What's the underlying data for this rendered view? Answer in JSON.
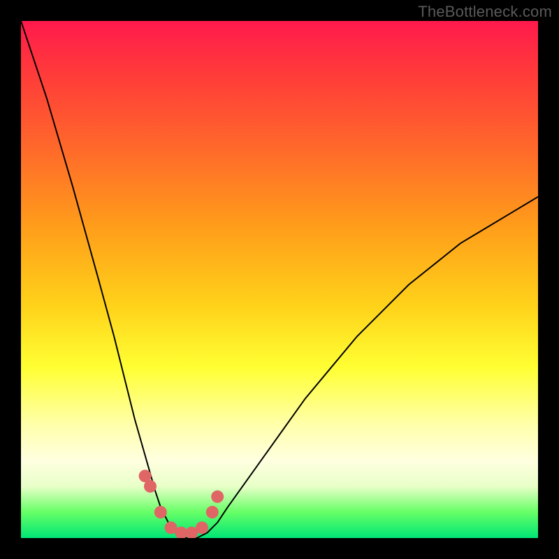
{
  "attribution": "TheBottleneck.com",
  "chart_data": {
    "type": "line",
    "title": "",
    "xlabel": "",
    "ylabel": "",
    "xlim": [
      0,
      100
    ],
    "ylim": [
      0,
      100
    ],
    "series": [
      {
        "name": "bottleneck-curve",
        "x": [
          0,
          5,
          10,
          15,
          18,
          20,
          22,
          24,
          26,
          27,
          28,
          29,
          30,
          32,
          34,
          36,
          38,
          40,
          45,
          50,
          55,
          60,
          65,
          70,
          75,
          80,
          85,
          90,
          95,
          100
        ],
        "values": [
          100,
          85,
          68,
          50,
          39,
          31,
          23,
          16,
          9,
          6,
          4,
          2,
          1,
          0,
          0,
          1,
          3,
          6,
          13,
          20,
          27,
          33,
          39,
          44,
          49,
          53,
          57,
          60,
          63,
          66
        ]
      }
    ],
    "markers": {
      "name": "highlight-dots",
      "color": "#e06666",
      "x": [
        24,
        25,
        27,
        29,
        31,
        33,
        35,
        37,
        38
      ],
      "values": [
        12,
        10,
        5,
        2,
        1,
        1,
        2,
        5,
        8
      ]
    },
    "background_gradient_stops": [
      {
        "pos": 0,
        "color": "#ff1a4d"
      },
      {
        "pos": 10,
        "color": "#ff3a3a"
      },
      {
        "pos": 25,
        "color": "#ff6a2a"
      },
      {
        "pos": 40,
        "color": "#ff9e1a"
      },
      {
        "pos": 55,
        "color": "#ffd21a"
      },
      {
        "pos": 67,
        "color": "#ffff33"
      },
      {
        "pos": 78,
        "color": "#ffffaa"
      },
      {
        "pos": 85,
        "color": "#ffffe0"
      },
      {
        "pos": 90,
        "color": "#e8ffc8"
      },
      {
        "pos": 95,
        "color": "#66ff66"
      },
      {
        "pos": 100,
        "color": "#00e676"
      }
    ]
  }
}
